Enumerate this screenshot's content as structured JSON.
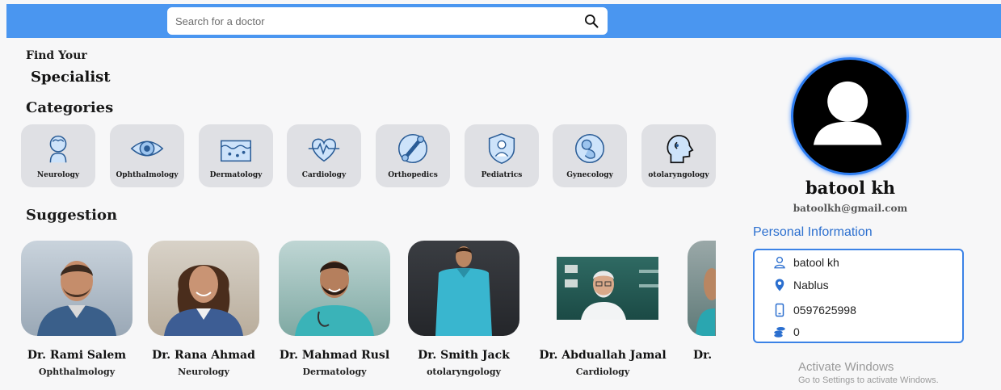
{
  "search": {
    "placeholder": "Search for a doctor",
    "icon": "search-icon"
  },
  "header": {
    "find_your": "Find Your",
    "specialist": "Specialist"
  },
  "categories": {
    "title": "Categories",
    "items": [
      {
        "label": "Neurology",
        "icon": "neurology-icon"
      },
      {
        "label": "Ophthalmology",
        "icon": "eye-icon"
      },
      {
        "label": "Dermatology",
        "icon": "skin-icon"
      },
      {
        "label": "Cardiology",
        "icon": "heart-icon"
      },
      {
        "label": "Orthopedics",
        "icon": "bone-icon"
      },
      {
        "label": "Pediatrics",
        "icon": "baby-icon"
      },
      {
        "label": "Gynecology",
        "icon": "fetus-icon"
      },
      {
        "label": "otolaryngology",
        "icon": "head-icon"
      }
    ]
  },
  "suggestion": {
    "title": "Suggestion",
    "doctors": [
      {
        "name": "Dr. Rami Salem",
        "specialty": "Ophthalmology"
      },
      {
        "name": "Dr. Rana Ahmad",
        "specialty": "Neurology"
      },
      {
        "name": "Dr. Mahmad Rusl",
        "specialty": "Dermatology"
      },
      {
        "name": "Dr. Smith Jack",
        "specialty": "otolaryngology"
      },
      {
        "name": "Dr. Abduallah Jamal",
        "specialty": "Cardiology"
      },
      {
        "name": "Dr.",
        "specialty": ""
      }
    ]
  },
  "profile": {
    "name": "batool kh",
    "email": "batoolkh@gmail.com",
    "section_title": "Personal Information",
    "rows": [
      {
        "icon": "person-icon",
        "value": "batool kh"
      },
      {
        "icon": "location-pin-icon",
        "value": "Nablus"
      },
      {
        "icon": "phone-icon",
        "value": "0597625998"
      },
      {
        "icon": "coins-icon",
        "value": "0"
      }
    ]
  },
  "watermark": {
    "title": "Activate Windows",
    "subtitle": "Go to Settings to activate Windows."
  },
  "colors": {
    "accent": "#4a96f0",
    "link": "#2b6fcf",
    "card_bg": "#dfe0e4"
  }
}
